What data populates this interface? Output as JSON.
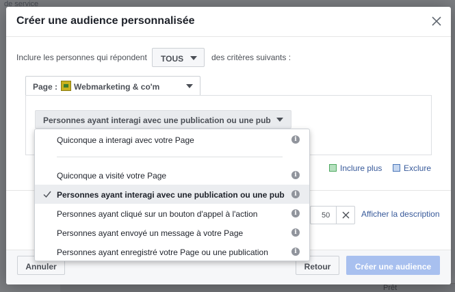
{
  "background": {
    "top_text": "de service",
    "bottom_right": "Prêt"
  },
  "modal": {
    "title": "Créer une audience personnalisée"
  },
  "include_row": {
    "prefix": "Inclure les personnes qui répondent",
    "match_select": "TOUS",
    "suffix": "des critères suivants :"
  },
  "page_select": {
    "label": "Page :",
    "page_name": "Webmarketing & co'm"
  },
  "interaction_select": {
    "value": "Personnes ayant interagi avec une publication ou une pub"
  },
  "links": {
    "include_more": "Inclure plus",
    "exclude": "Exclure",
    "show_description": "Afficher la description"
  },
  "days": {
    "value": "50"
  },
  "footer": {
    "cancel": "Annuler",
    "back": "Retour",
    "create": "Créer une audience"
  },
  "dropdown": {
    "items": [
      {
        "label": "Quiconque a interagi avec votre Page"
      },
      {
        "label": "Quiconque a visité votre Page"
      },
      {
        "label": "Personnes ayant interagi avec une publication ou une pub",
        "selected": true
      },
      {
        "label": "Personnes ayant cliqué sur un bouton d'appel à l'action"
      },
      {
        "label": "Personnes ayant envoyé un message à votre Page"
      },
      {
        "label": "Personnes ayant enregistré votre Page ou une publication"
      }
    ]
  },
  "colors": {
    "link": "#365899",
    "primary_disabled": "#a8c0ef",
    "selected_row": "#ebedf0"
  }
}
